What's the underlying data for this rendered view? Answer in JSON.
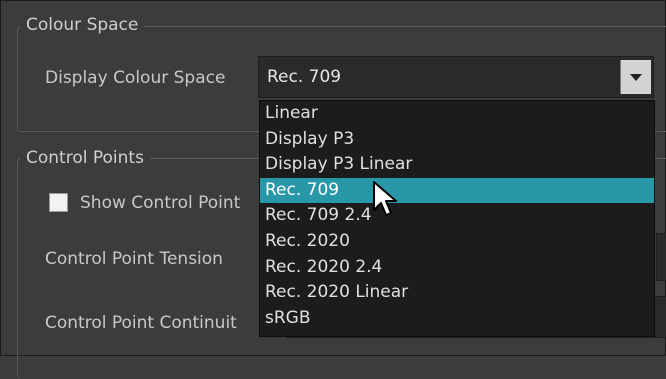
{
  "colour_space": {
    "title": "Colour Space",
    "display_label": "Display Colour Space",
    "selected_value": "Rec. 709",
    "options": [
      "Linear",
      "Display P3",
      "Display P3 Linear",
      "Rec. 709",
      "Rec. 709 2.4",
      "Rec. 2020",
      "Rec. 2020  2.4",
      "Rec. 2020 Linear",
      "sRGB"
    ],
    "highlighted_index": 3
  },
  "control_points": {
    "title": "Control Points",
    "show_label": "Show Control Point",
    "tension_label": "Control Point Tension",
    "continuity_label": "Control Point Continuit"
  },
  "colors": {
    "background": "#3c3c3c",
    "highlight": "#2898a8",
    "dropdown_bg": "#1c1c1c"
  },
  "icons": [
    "chevron-down-icon",
    "mouse-pointer-icon",
    "checkbox-icon"
  ]
}
